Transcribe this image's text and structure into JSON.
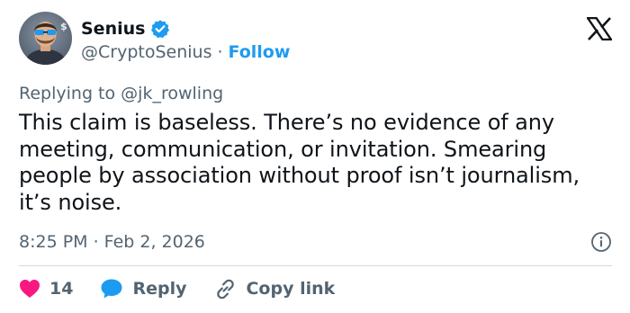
{
  "author": {
    "display_name": "Senius",
    "handle": "@CryptoSenius",
    "separator": "·",
    "follow_label": "Follow",
    "verified": true,
    "avatar_icon": "avatar-sunglasses-man"
  },
  "platform": {
    "logo_icon": "x-logo-icon"
  },
  "reply_context": {
    "prefix": "Replying to",
    "mention": "@jk_rowling"
  },
  "tweet": {
    "text": "This claim is baseless. There’s no evidence of any meeting, communication, or invitation. Smearing people by association without proof isn’t journalism, it’s noise.",
    "timestamp": "8:25 PM · Feb 2, 2026"
  },
  "actions": {
    "like_count": "14",
    "reply_label": "Reply",
    "copy_link_label": "Copy link"
  },
  "colors": {
    "accent": "#1d9bf0",
    "like": "#f91880",
    "secondary_text": "#536471",
    "primary_text": "#0f1419",
    "divider": "#cfd9de"
  }
}
